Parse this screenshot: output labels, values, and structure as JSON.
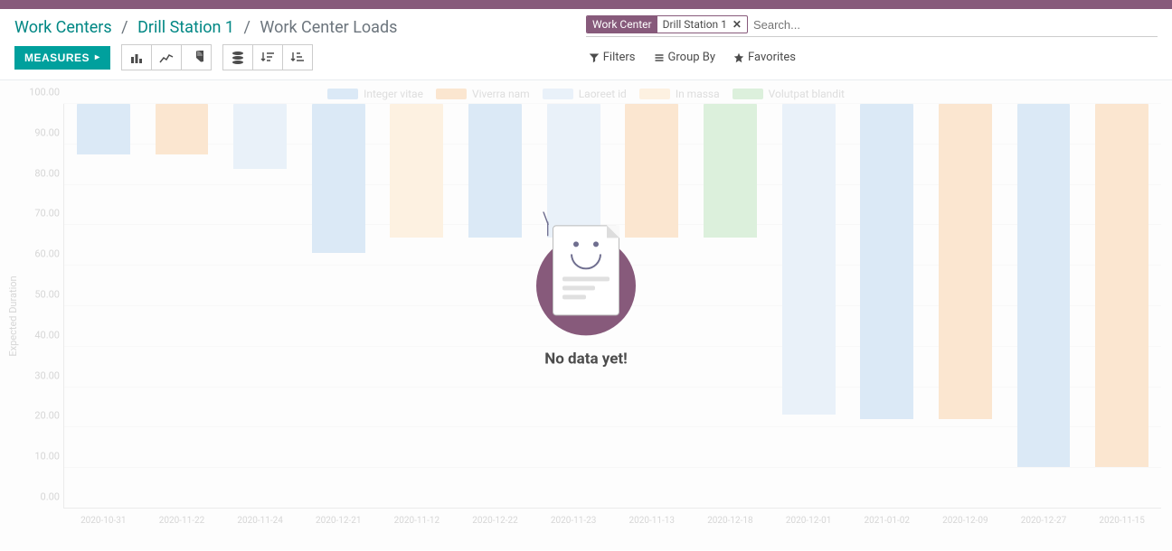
{
  "breadcrumbs": {
    "link1": "Work Centers",
    "link2": "Drill Station 1",
    "current": "Work Center Loads"
  },
  "search": {
    "facet_label": "Work Center",
    "facet_value": "Drill Station 1",
    "placeholder": "Search..."
  },
  "toolbar": {
    "measures": "MEASURES",
    "filters": "Filters",
    "group_by": "Group By",
    "favorites": "Favorites"
  },
  "nodata": {
    "text": "No data yet!"
  },
  "legend_colors": {
    "Integer vitae": "#a6c8e8",
    "Viverra nam": "#f5c08a",
    "Laoreet id": "#c9ddf0",
    "In massa": "#f9dbb5",
    "Volutpat blandit": "#a7d9a7"
  },
  "chart_data": {
    "type": "bar",
    "ylabel": "Expected Duration",
    "ylim": [
      0,
      100
    ],
    "yticks": [
      0.0,
      10.0,
      20.0,
      30.0,
      40.0,
      50.0,
      60.0,
      70.0,
      80.0,
      90.0,
      100.0
    ],
    "series": [
      {
        "name": "Integer vitae",
        "values": [
          12.5,
          null,
          null,
          37,
          null,
          33,
          null,
          null,
          null,
          null,
          78,
          null,
          90,
          null
        ]
      },
      {
        "name": "Viverra nam",
        "values": [
          null,
          12.5,
          null,
          null,
          null,
          null,
          null,
          33,
          null,
          null,
          null,
          78,
          null,
          90
        ]
      },
      {
        "name": "Laoreet id",
        "values": [
          null,
          null,
          16,
          null,
          null,
          null,
          33,
          null,
          null,
          77,
          null,
          null,
          null,
          null
        ]
      },
      {
        "name": "In massa",
        "values": [
          null,
          null,
          null,
          null,
          33,
          null,
          null,
          null,
          null,
          null,
          null,
          null,
          null,
          null
        ]
      },
      {
        "name": "Volutpat blandit",
        "values": [
          null,
          null,
          null,
          null,
          null,
          null,
          null,
          null,
          33,
          null,
          null,
          null,
          null,
          null
        ]
      }
    ],
    "categories": [
      "2020-10-31",
      "2020-11-22",
      "2020-11-24",
      "2020-12-21",
      "2020-11-12",
      "2020-12-22",
      "2020-11-23",
      "2020-11-13",
      "2020-12-18",
      "2020-12-01",
      "2021-01-02",
      "2020-12-09",
      "2020-12-27",
      "2020-11-15"
    ]
  }
}
